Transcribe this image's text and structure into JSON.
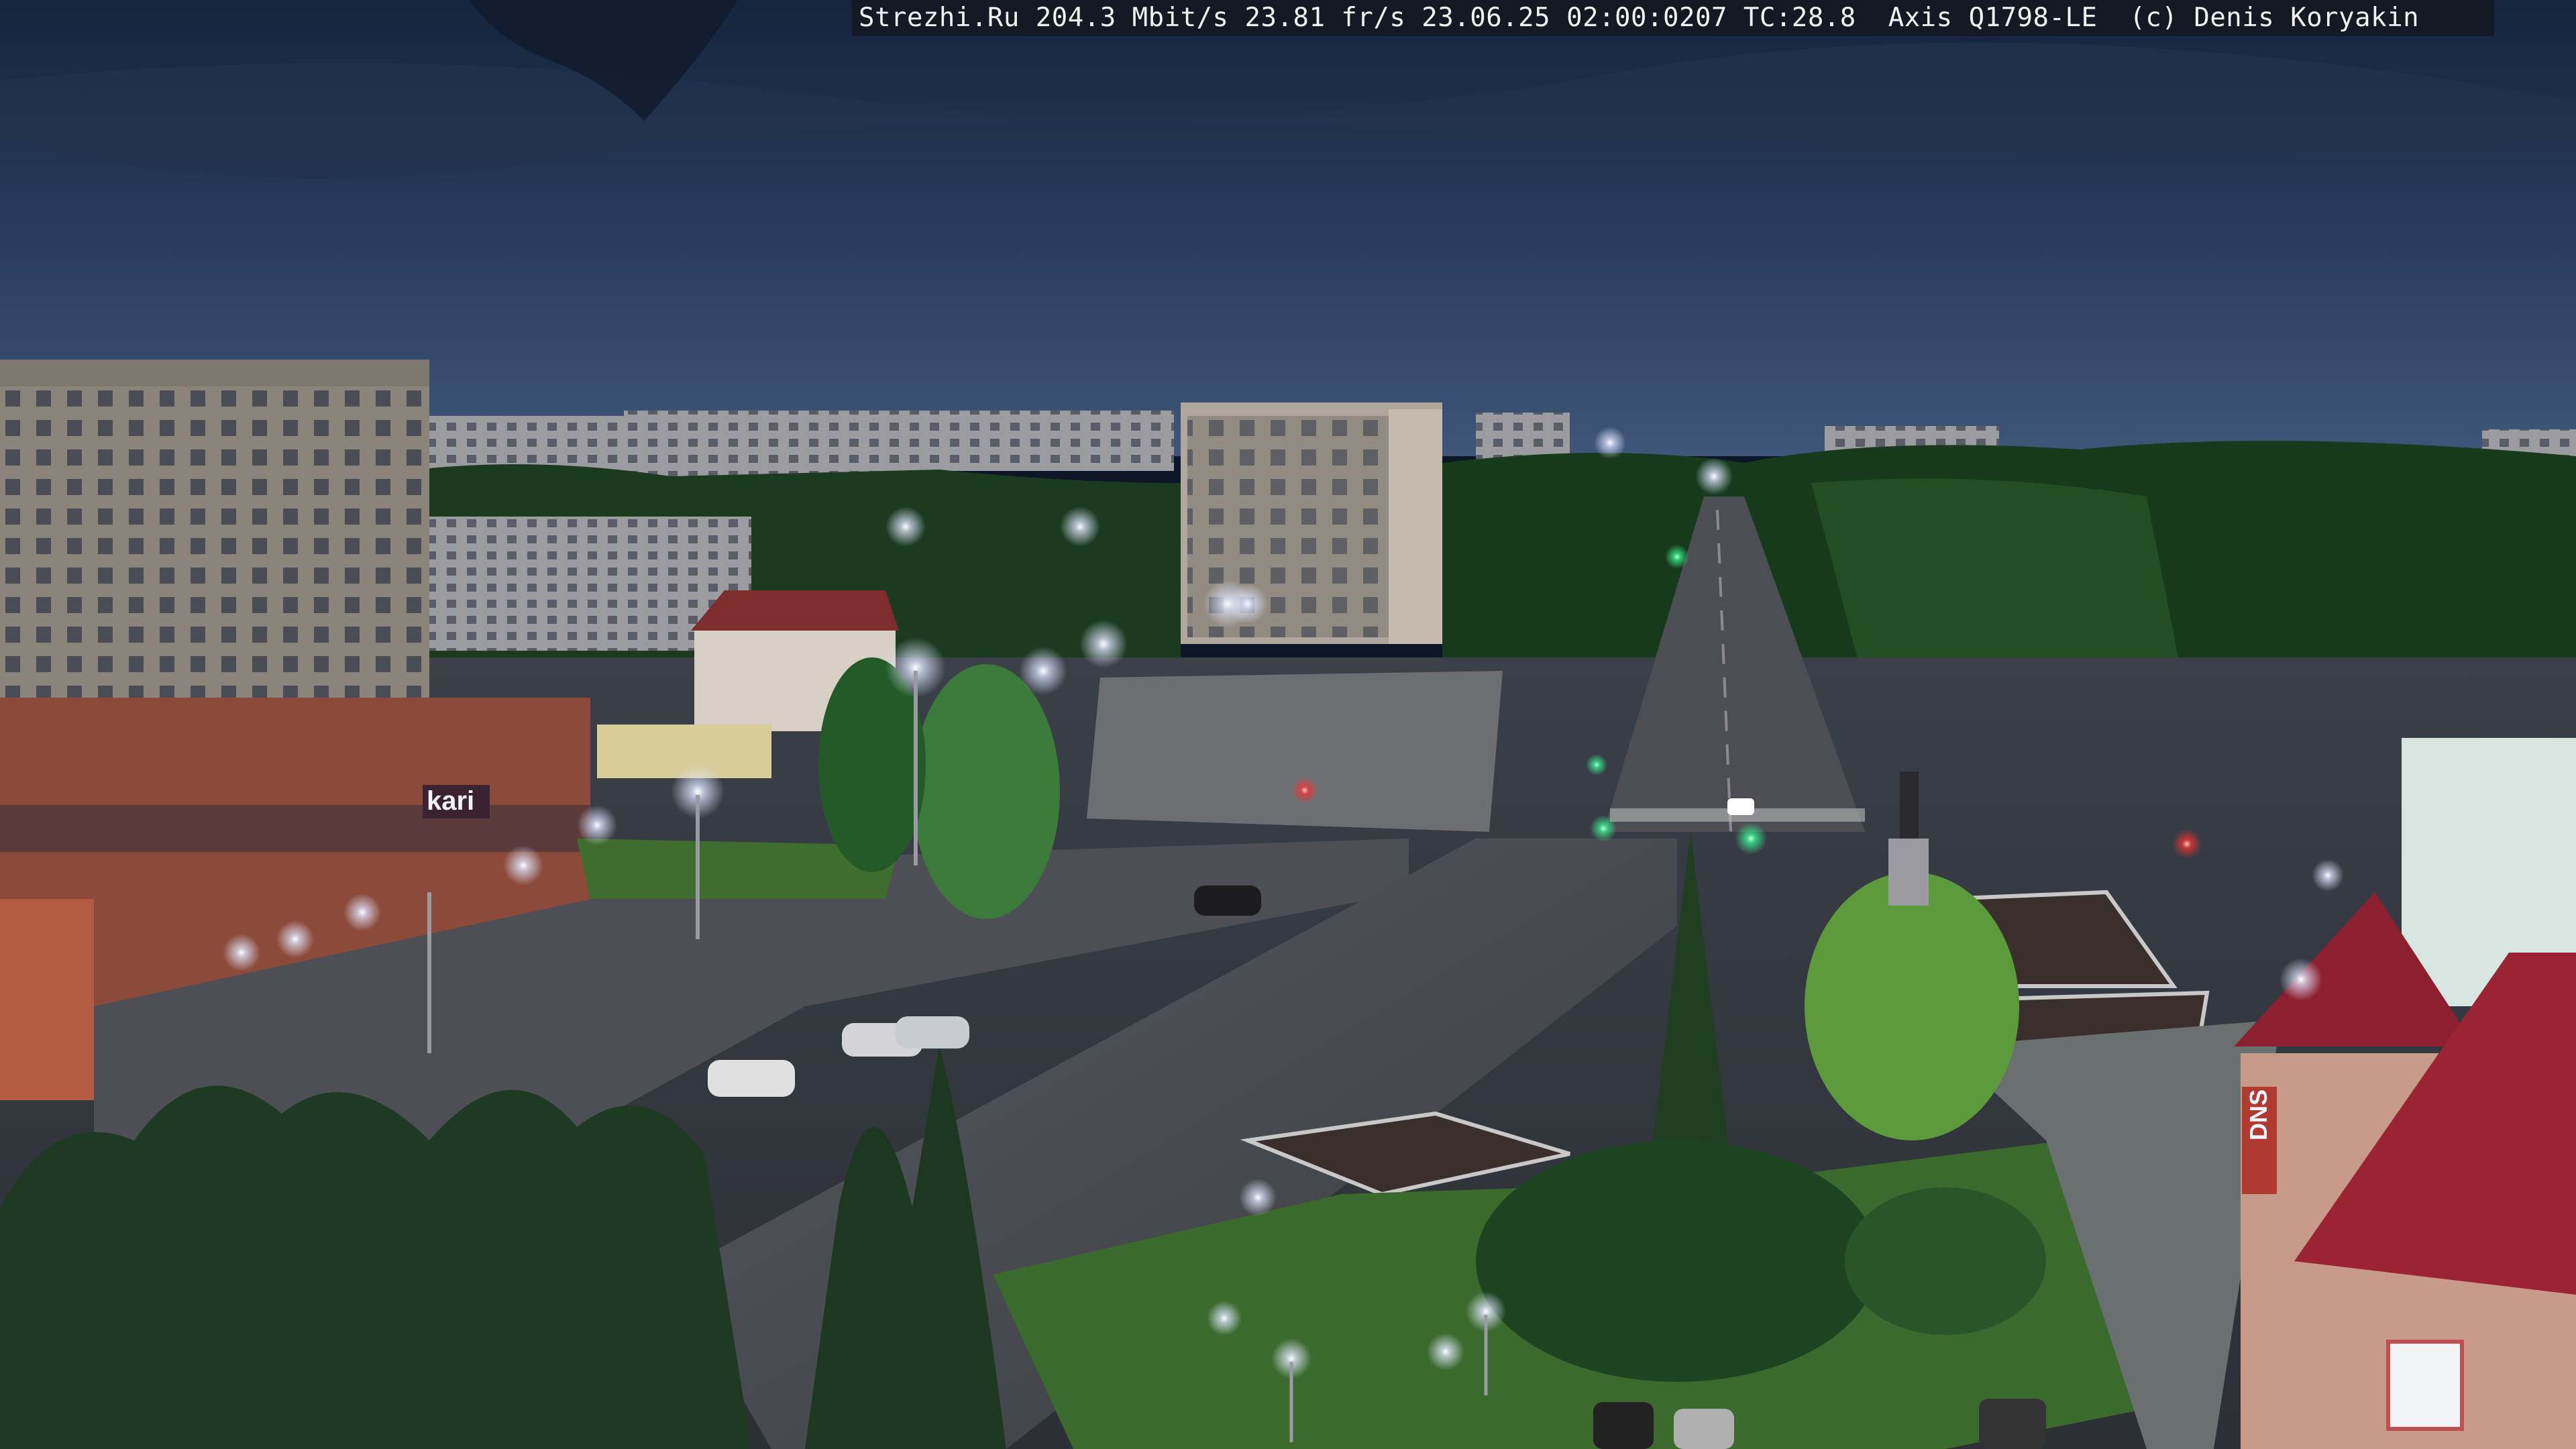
{
  "overlay": {
    "text": "Strezhi.Ru 204.3 Mbit/s 23.81 fr/s 23.06.25 02:00:0207 TC:28.8  Axis Q1798-LE  (c) Denis Koryakin"
  },
  "signs": {
    "store_left": "kari",
    "store_right": "DNS"
  },
  "colors": {
    "sky_top": "#1c2b46",
    "sky_horizon": "#3b5275",
    "trees": "#173a1c",
    "street_light": "#e8ecff",
    "traffic_green": "#3cff9a",
    "traffic_red": "#ff3030"
  }
}
